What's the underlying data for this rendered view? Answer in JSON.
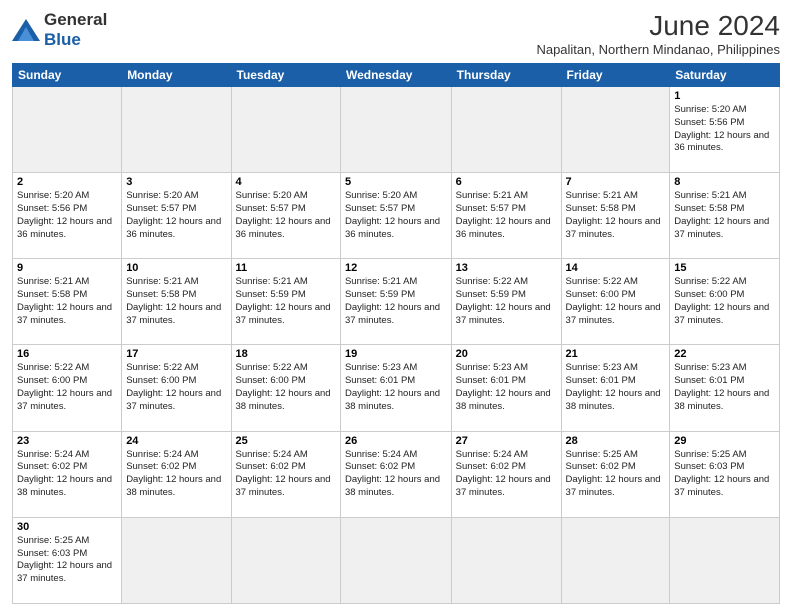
{
  "logo": {
    "text_general": "General",
    "text_blue": "Blue"
  },
  "header": {
    "title": "June 2024",
    "subtitle": "Napalitan, Northern Mindanao, Philippines"
  },
  "weekdays": [
    "Sunday",
    "Monday",
    "Tuesday",
    "Wednesday",
    "Thursday",
    "Friday",
    "Saturday"
  ],
  "weeks": [
    [
      {
        "day": "",
        "empty": true
      },
      {
        "day": "",
        "empty": true
      },
      {
        "day": "",
        "empty": true
      },
      {
        "day": "",
        "empty": true
      },
      {
        "day": "",
        "empty": true
      },
      {
        "day": "",
        "empty": true
      },
      {
        "day": "1",
        "sunrise": "5:20 AM",
        "sunset": "5:56 PM",
        "daylight": "12 hours and 36 minutes."
      }
    ],
    [
      {
        "day": "2",
        "sunrise": "5:20 AM",
        "sunset": "5:56 PM",
        "daylight": "12 hours and 36 minutes."
      },
      {
        "day": "3",
        "sunrise": "5:20 AM",
        "sunset": "5:57 PM",
        "daylight": "12 hours and 36 minutes."
      },
      {
        "day": "4",
        "sunrise": "5:20 AM",
        "sunset": "5:57 PM",
        "daylight": "12 hours and 36 minutes."
      },
      {
        "day": "5",
        "sunrise": "5:20 AM",
        "sunset": "5:57 PM",
        "daylight": "12 hours and 36 minutes."
      },
      {
        "day": "6",
        "sunrise": "5:21 AM",
        "sunset": "5:57 PM",
        "daylight": "12 hours and 36 minutes."
      },
      {
        "day": "7",
        "sunrise": "5:21 AM",
        "sunset": "5:58 PM",
        "daylight": "12 hours and 37 minutes."
      },
      {
        "day": "8",
        "sunrise": "5:21 AM",
        "sunset": "5:58 PM",
        "daylight": "12 hours and 37 minutes."
      }
    ],
    [
      {
        "day": "9",
        "sunrise": "5:21 AM",
        "sunset": "5:58 PM",
        "daylight": "12 hours and 37 minutes."
      },
      {
        "day": "10",
        "sunrise": "5:21 AM",
        "sunset": "5:58 PM",
        "daylight": "12 hours and 37 minutes."
      },
      {
        "day": "11",
        "sunrise": "5:21 AM",
        "sunset": "5:59 PM",
        "daylight": "12 hours and 37 minutes."
      },
      {
        "day": "12",
        "sunrise": "5:21 AM",
        "sunset": "5:59 PM",
        "daylight": "12 hours and 37 minutes."
      },
      {
        "day": "13",
        "sunrise": "5:22 AM",
        "sunset": "5:59 PM",
        "daylight": "12 hours and 37 minutes."
      },
      {
        "day": "14",
        "sunrise": "5:22 AM",
        "sunset": "6:00 PM",
        "daylight": "12 hours and 37 minutes."
      },
      {
        "day": "15",
        "sunrise": "5:22 AM",
        "sunset": "6:00 PM",
        "daylight": "12 hours and 37 minutes."
      }
    ],
    [
      {
        "day": "16",
        "sunrise": "5:22 AM",
        "sunset": "6:00 PM",
        "daylight": "12 hours and 37 minutes."
      },
      {
        "day": "17",
        "sunrise": "5:22 AM",
        "sunset": "6:00 PM",
        "daylight": "12 hours and 37 minutes."
      },
      {
        "day": "18",
        "sunrise": "5:22 AM",
        "sunset": "6:00 PM",
        "daylight": "12 hours and 38 minutes."
      },
      {
        "day": "19",
        "sunrise": "5:23 AM",
        "sunset": "6:01 PM",
        "daylight": "12 hours and 38 minutes."
      },
      {
        "day": "20",
        "sunrise": "5:23 AM",
        "sunset": "6:01 PM",
        "daylight": "12 hours and 38 minutes."
      },
      {
        "day": "21",
        "sunrise": "5:23 AM",
        "sunset": "6:01 PM",
        "daylight": "12 hours and 38 minutes."
      },
      {
        "day": "22",
        "sunrise": "5:23 AM",
        "sunset": "6:01 PM",
        "daylight": "12 hours and 38 minutes."
      }
    ],
    [
      {
        "day": "23",
        "sunrise": "5:24 AM",
        "sunset": "6:02 PM",
        "daylight": "12 hours and 38 minutes."
      },
      {
        "day": "24",
        "sunrise": "5:24 AM",
        "sunset": "6:02 PM",
        "daylight": "12 hours and 38 minutes."
      },
      {
        "day": "25",
        "sunrise": "5:24 AM",
        "sunset": "6:02 PM",
        "daylight": "12 hours and 37 minutes."
      },
      {
        "day": "26",
        "sunrise": "5:24 AM",
        "sunset": "6:02 PM",
        "daylight": "12 hours and 38 minutes."
      },
      {
        "day": "27",
        "sunrise": "5:24 AM",
        "sunset": "6:02 PM",
        "daylight": "12 hours and 37 minutes."
      },
      {
        "day": "28",
        "sunrise": "5:25 AM",
        "sunset": "6:02 PM",
        "daylight": "12 hours and 37 minutes."
      },
      {
        "day": "29",
        "sunrise": "5:25 AM",
        "sunset": "6:03 PM",
        "daylight": "12 hours and 37 minutes."
      }
    ],
    [
      {
        "day": "30",
        "sunrise": "5:25 AM",
        "sunset": "6:03 PM",
        "daylight": "12 hours and 37 minutes."
      },
      {
        "day": "",
        "empty": true
      },
      {
        "day": "",
        "empty": true
      },
      {
        "day": "",
        "empty": true
      },
      {
        "day": "",
        "empty": true
      },
      {
        "day": "",
        "empty": true
      },
      {
        "day": "",
        "empty": true
      }
    ]
  ],
  "colors": {
    "header_bg": "#1a5fa8",
    "header_text": "#ffffff",
    "border": "#cccccc",
    "empty_cell": "#f0f0f0"
  }
}
